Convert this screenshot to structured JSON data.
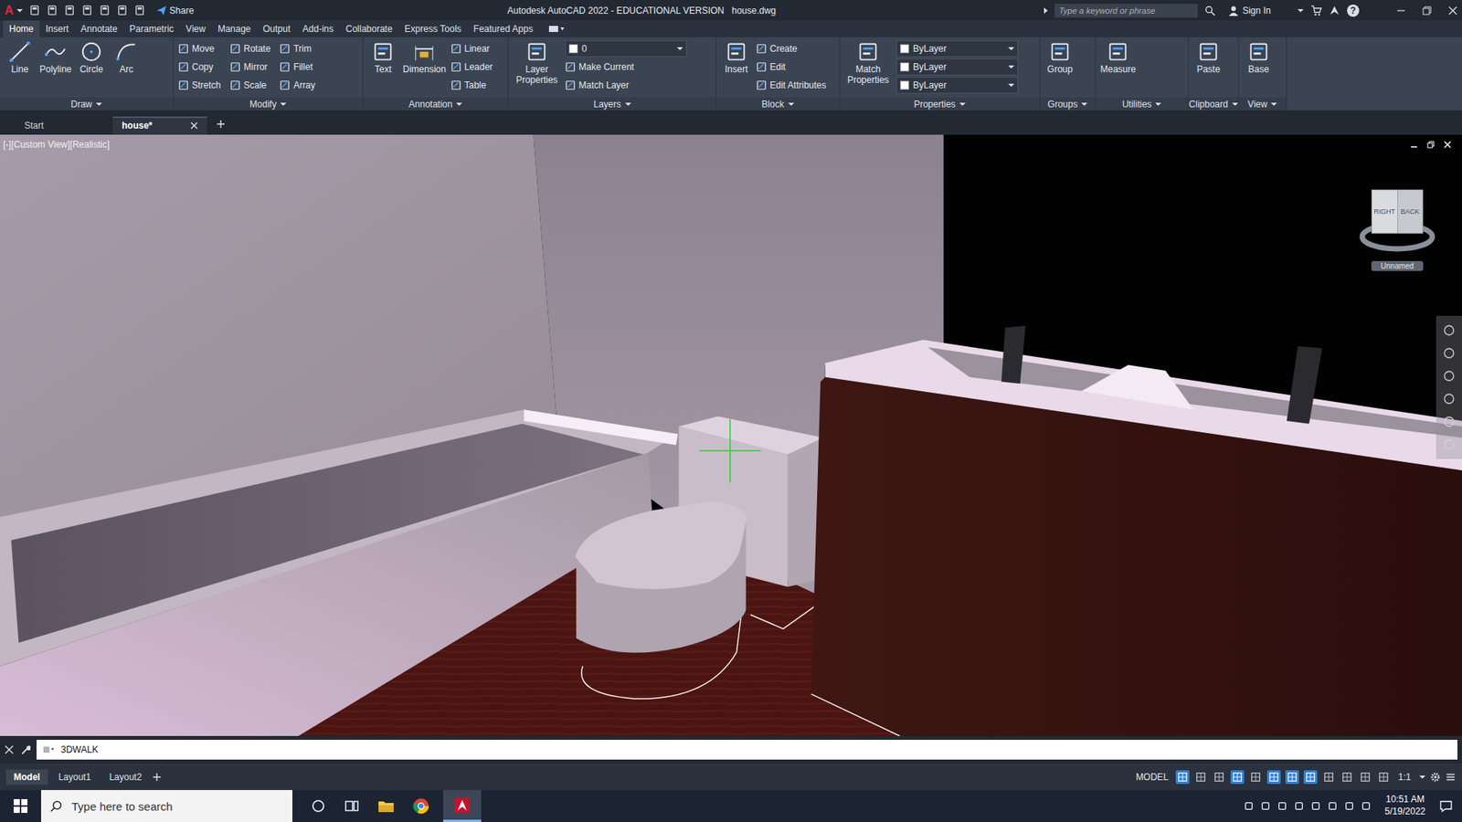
{
  "title_bar": {
    "app_logo": "A",
    "share": "Share",
    "title": "Autodesk AutoCAD 2022 - EDUCATIONAL VERSION",
    "file": "house.dwg",
    "search_placeholder": "Type a keyword or phrase",
    "sign_in": "Sign In",
    "help": "?"
  },
  "ribbon_tabs": [
    {
      "label": "Home",
      "selected": true
    },
    {
      "label": "Insert",
      "selected": false
    },
    {
      "label": "Annotate",
      "selected": false
    },
    {
      "label": "Parametric",
      "selected": false
    },
    {
      "label": "View",
      "selected": false
    },
    {
      "label": "Manage",
      "selected": false
    },
    {
      "label": "Output",
      "selected": false
    },
    {
      "label": "Add-ins",
      "selected": false
    },
    {
      "label": "Collaborate",
      "selected": false
    },
    {
      "label": "Express Tools",
      "selected": false
    },
    {
      "label": "Featured Apps",
      "selected": false
    }
  ],
  "panels": [
    {
      "name": "Draw",
      "large": [
        "Line",
        "Polyline",
        "Circle",
        "Arc"
      ],
      "small": []
    },
    {
      "name": "Modify",
      "large": [],
      "small": [
        {
          "label": "Move",
          "kind": "button"
        },
        {
          "label": "Rotate",
          "kind": "button"
        },
        {
          "label": "Trim",
          "kind": "button"
        },
        {
          "label": "Copy",
          "kind": "button"
        },
        {
          "label": "Mirror",
          "kind": "button"
        },
        {
          "label": "Fillet",
          "kind": "button"
        },
        {
          "label": "Stretch",
          "kind": "button"
        },
        {
          "label": "Scale",
          "kind": "button"
        },
        {
          "label": "Array",
          "kind": "button"
        }
      ]
    },
    {
      "name": "Annotation",
      "large": [
        "Text",
        "Dimension"
      ],
      "small": [
        {
          "label": "Linear",
          "kind": "button"
        },
        {
          "label": "Leader",
          "kind": "button"
        },
        {
          "label": "Table",
          "kind": "button"
        }
      ]
    },
    {
      "name": "Layers",
      "large": [
        "Layer Properties"
      ],
      "small": [
        {
          "label": "0",
          "kind": "dropdown"
        },
        {
          "label": "Make Current",
          "kind": "button"
        },
        {
          "label": "Match Layer",
          "kind": "button"
        }
      ]
    },
    {
      "name": "Block",
      "large": [
        "Insert"
      ],
      "small": [
        {
          "label": "Create",
          "kind": "button"
        },
        {
          "label": "Edit",
          "kind": "button"
        },
        {
          "label": "Edit Attributes",
          "kind": "button"
        }
      ]
    },
    {
      "name": "Properties",
      "large": [
        "Match Properties"
      ],
      "small": [
        {
          "label": "ByLayer",
          "kind": "dropdown"
        },
        {
          "label": "ByLayer",
          "kind": "dropdown"
        },
        {
          "label": "ByLayer",
          "kind": "dropdown"
        }
      ]
    },
    {
      "name": "Groups",
      "large": [
        "Group"
      ],
      "small": []
    },
    {
      "name": "Utilities",
      "large": [
        "Measure"
      ],
      "small": []
    },
    {
      "name": "Clipboard",
      "large": [
        "Paste"
      ],
      "small": []
    },
    {
      "name": "View",
      "large": [
        "Base"
      ],
      "small": []
    }
  ],
  "file_tabs": [
    {
      "label": "Start",
      "selected": false,
      "closable": false
    },
    {
      "label": "house*",
      "selected": true,
      "closable": true
    }
  ],
  "viewport": {
    "label": "[-][Custom View][Realistic]",
    "cube_faces": [
      "RIGHT",
      "BACK"
    ],
    "ucs": "Unnamed"
  },
  "command_line": {
    "value": "3DWALK"
  },
  "layout_tabs": [
    {
      "label": "Model",
      "selected": true
    },
    {
      "label": "Layout1",
      "selected": false
    },
    {
      "label": "Layout2",
      "selected": false
    }
  ],
  "status_bar": {
    "model": "MODEL",
    "scale": "1:1",
    "toggles": [
      {
        "on": true
      },
      {
        "on": false
      },
      {
        "on": false
      },
      {
        "on": true
      },
      {
        "on": false
      },
      {
        "on": true
      },
      {
        "on": true
      },
      {
        "on": true
      },
      {
        "on": false
      },
      {
        "on": false
      },
      {
        "on": false
      },
      {
        "on": false
      }
    ]
  },
  "taskbar": {
    "search": "Type here to search",
    "time": "10:51 AM",
    "date": "5/19/2022"
  }
}
